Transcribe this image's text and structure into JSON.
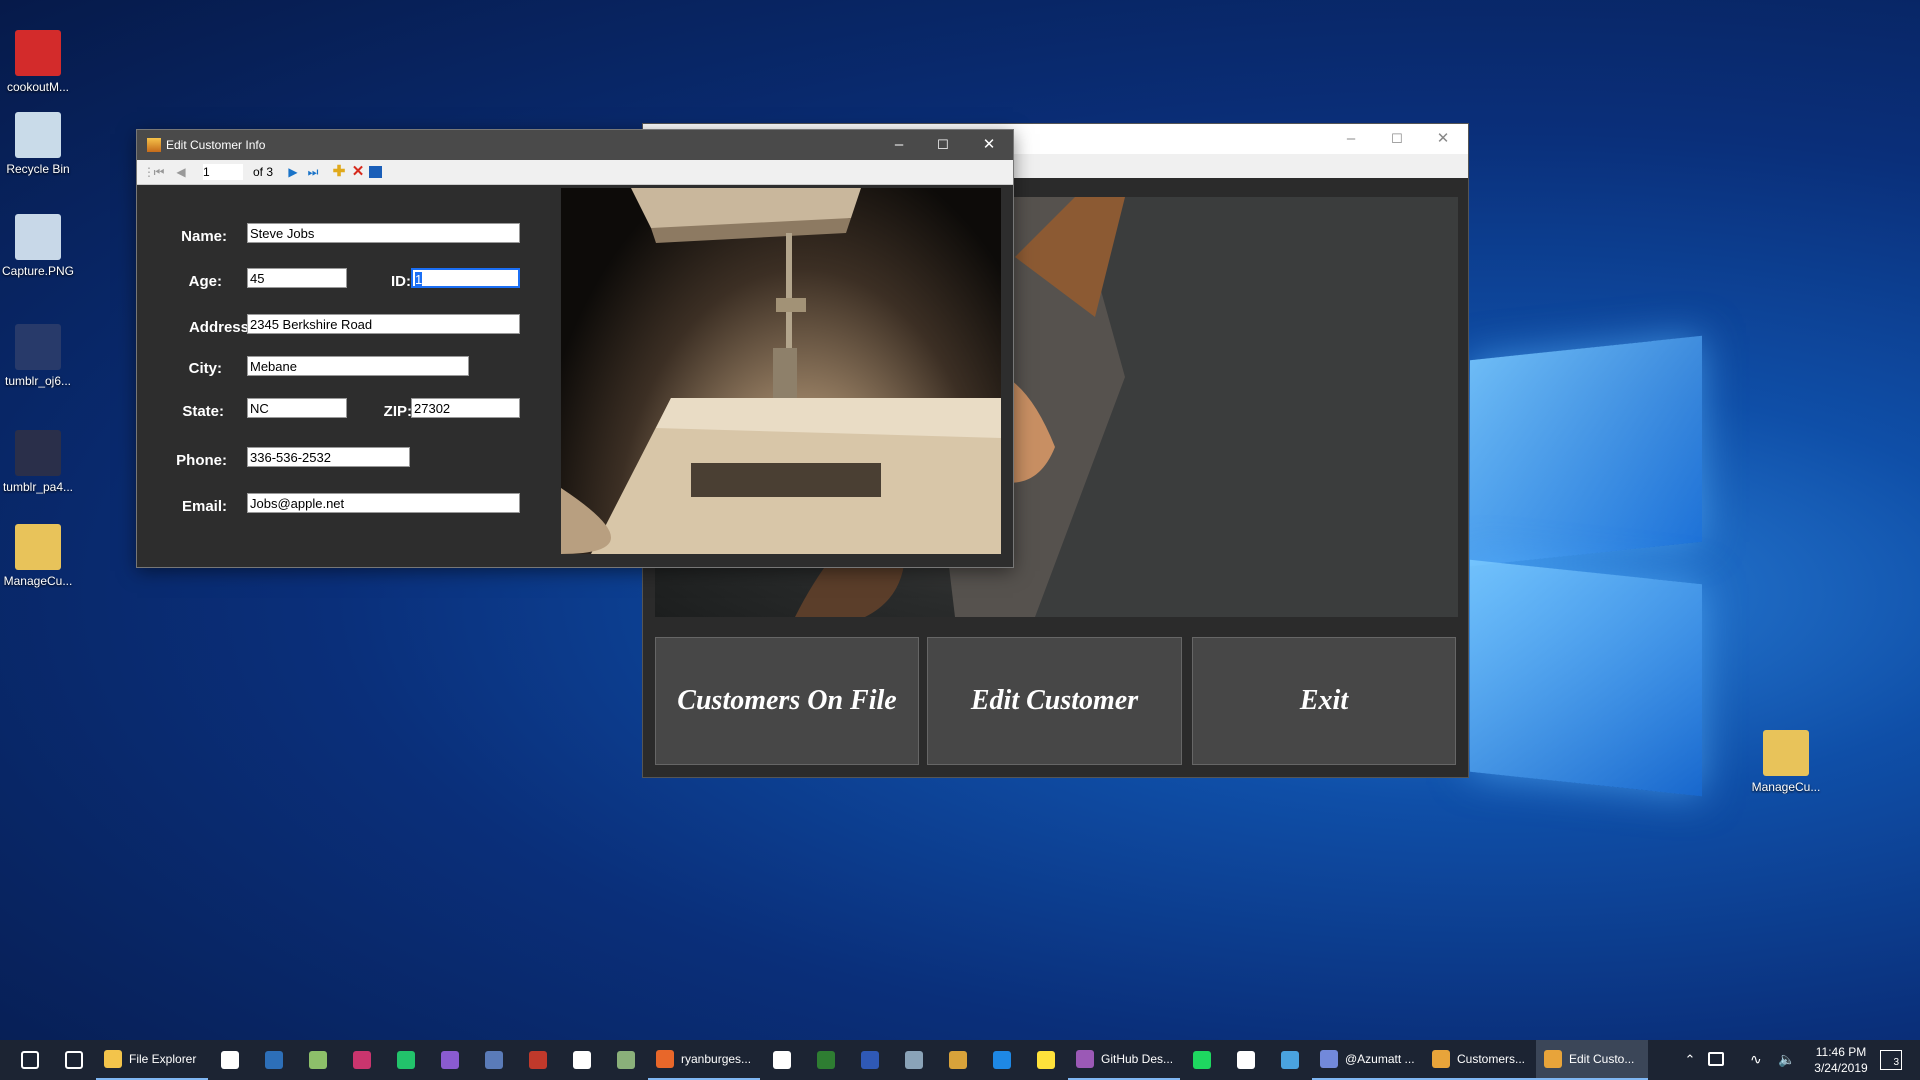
{
  "desktop": {
    "icons": [
      {
        "label": "cookoutM...",
        "icon": "image-file-icon",
        "color": "#d32b2b"
      },
      {
        "label": "Recycle Bin",
        "icon": "recycle-bin-icon",
        "color": "#c9dbe9"
      },
      {
        "label": "Capture.PNG",
        "icon": "png-file-icon",
        "color": "#c8d8e8"
      },
      {
        "label": "tumblr_oj6...",
        "icon": "video-file-icon",
        "color": "#283a6a"
      },
      {
        "label": "tumblr_pa4...",
        "icon": "video-file-icon",
        "color": "#2a2f4a"
      },
      {
        "label": "ManageCu...",
        "icon": "zip-folder-icon",
        "color": "#e8c35a"
      },
      {
        "label": "ManageCu...",
        "icon": "zip-folder-icon",
        "color": "#e8c35a"
      }
    ]
  },
  "main_window": {
    "buttons": [
      {
        "label": "Customers On File"
      },
      {
        "label": "Edit Customer"
      },
      {
        "label": "Exit"
      }
    ]
  },
  "edit_window": {
    "title": "Edit Customer Info",
    "navigator": {
      "position": "1",
      "count_label": "of 3"
    },
    "labels": {
      "name": "Name:",
      "age": "Age:",
      "id": "ID:",
      "address": "Address:",
      "city": "City:",
      "state": "State:",
      "zip": "ZIP:",
      "phone": "Phone:",
      "email": "Email:"
    },
    "values": {
      "name": "Steve Jobs",
      "age": "45",
      "id": "1",
      "address": "2345 Berkshire Road",
      "city": "Mebane",
      "state": "NC",
      "zip": "27302",
      "phone": "336-536-2532",
      "email": "Jobs@apple.net"
    }
  },
  "taskbar": {
    "items": [
      {
        "label": "",
        "icon": "windows-start-icon"
      },
      {
        "label": "",
        "icon": "task-view-icon"
      },
      {
        "label": "File Explorer",
        "icon": "file-explorer-icon"
      },
      {
        "label": "",
        "icon": "mail-icon"
      },
      {
        "label": "",
        "icon": "powershell-icon"
      },
      {
        "label": "",
        "icon": "notepad-icon"
      },
      {
        "label": "",
        "icon": "intellij-icon"
      },
      {
        "label": "",
        "icon": "pycharm-icon"
      },
      {
        "label": "",
        "icon": "visual-studio-icon"
      },
      {
        "label": "",
        "icon": "sql-server-icon"
      },
      {
        "label": "",
        "icon": "access-icon"
      },
      {
        "label": "",
        "icon": "calendar-icon"
      },
      {
        "label": "",
        "icon": "photos-icon"
      },
      {
        "label": "ryanburges...",
        "icon": "firefox-icon"
      },
      {
        "label": "",
        "icon": "calculator-icon"
      },
      {
        "label": "",
        "icon": "project-icon"
      },
      {
        "label": "",
        "icon": "visio-icon"
      },
      {
        "label": "",
        "icon": "mysql-icon"
      },
      {
        "label": "",
        "icon": "dosbox-icon"
      },
      {
        "label": "",
        "icon": "edge-icon"
      },
      {
        "label": "",
        "icon": "sticky-notes-icon"
      },
      {
        "label": "GitHub Des...",
        "icon": "github-desktop-icon"
      },
      {
        "label": "",
        "icon": "spotify-icon"
      },
      {
        "label": "",
        "icon": "settings-gear-icon"
      },
      {
        "label": "",
        "icon": "remote-desktop-icon"
      },
      {
        "label": "@Azumatt ...",
        "icon": "discord-icon"
      },
      {
        "label": "Customers...",
        "icon": "app-window-icon"
      },
      {
        "label": "Edit Custo...",
        "icon": "app-window-icon"
      }
    ],
    "clock": {
      "time": "11:46 PM",
      "date": "3/24/2019"
    },
    "notification_count": "3"
  }
}
